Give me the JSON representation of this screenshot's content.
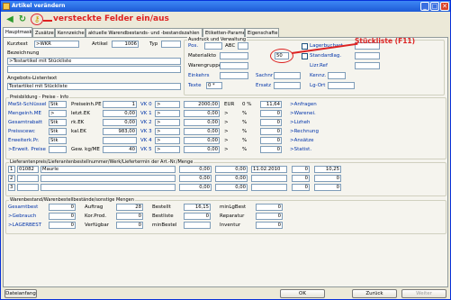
{
  "window": {
    "title": "Artikel verändern",
    "min": "_",
    "max": "□",
    "close": "✕"
  },
  "toolbar": {
    "icon1": "green-back-arrow",
    "icon2": "refresh-icon",
    "icon3": "key-icon",
    "annotation": "versteckte Felder ein/aus"
  },
  "tabs": [
    "Hauptmaske",
    "Zusätze",
    "Kennzeichen",
    "aktuelle Warendbestands- und -bestandszahlen",
    "Etiketten-Parameter",
    "Eigenschaften"
  ],
  "main": {
    "kurztext_label": "Kurztext",
    "kurztext_value": ">WKR",
    "artikel_label": "Artikel",
    "artikel_value": "1006",
    "typ_label": "Typ",
    "bezeichnung_label": "Bezeichnung",
    "bez1": ">Testartikel mit Stückliste",
    "angebots_label": "Angebots-Listentext",
    "angebots_value": "Testartikel mit Stückliste"
  },
  "right_group": {
    "title": "Ausdruck und Verwaltung",
    "pos_label": "Pos.",
    "abc_label": "ABC",
    "lagerbuch_label": "Lagerbuchart",
    "material_label": "Materialkto",
    "material_value": "50",
    "standardlag_label": "Standardlag.",
    "warengruppe_label": "Warengruppe",
    "lizref_label": "Lizr.Ref",
    "einkehrs_label": "Einkehrs",
    "sachnr_label": "Sachnr",
    "kennz_label": "Kennz.",
    "texte_label": "Texte",
    "texte_value": "0 *",
    "ersatz_label": "Ersatz",
    "lgort_label": "Lg-Ort",
    "stueckliste_annotation": "Stückliste (F11)"
  },
  "preis": {
    "title": "Preisbildung - Preise - Info",
    "rows": [
      {
        "label": "MwSt-Schlüssel",
        "unit": "Stk",
        "mid_label": "Preiseinh.PE",
        "mid_value": "1",
        "vk": "VK 0",
        "vk_label": ">",
        "price": "2000,00",
        "cur": "EUR",
        "pct": "0 %",
        "extra": "11,64",
        "link": ">Anfragen"
      },
      {
        "label": "Mengeinh.ME",
        "unit": ">",
        "mid_label": "letzt.EK",
        "mid_value": "0,00",
        "vk": "VK 1",
        "vk_label": ">",
        "price": "0,00",
        "cur": ">",
        "pct": "%",
        "extra": "0",
        "link": ">Warenei."
      },
      {
        "label": "Gesamtrabatt",
        "unit": "Stk",
        "mid_label": "rk.EK",
        "mid_value": "0,00",
        "vk": "VK 2",
        "vk_label": ">",
        "price": "0,00",
        "cur": ">",
        "pct": "%",
        "extra": "0",
        "link": ">Lizheh"
      },
      {
        "label": "Preisscewc",
        "unit": "Stk",
        "mid_label": "kal.EK",
        "mid_value": "983,00",
        "vk": "VK 3",
        "vk_label": ">",
        "price": "0,00",
        "cur": ">",
        "pct": "%",
        "extra": "0",
        "link": ">Rechnung"
      },
      {
        "label": "Erweiterk.Pr.",
        "unit": "Stk",
        "mid_label": "",
        "mid_value": "",
        "vk": "VK 4",
        "vk_label": ">",
        "price": "0,00",
        "cur": ">",
        "pct": "%",
        "extra": "0",
        "link": ">Ansätze"
      },
      {
        "label": ">Erweit. Preise",
        "unit": "",
        "mid_label": "Gew. kg/ME",
        "mid_value": "40",
        "vk": "VK 5",
        "vk_label": ">",
        "price": "0,00",
        "cur": ">",
        "pct": "%",
        "extra": "0",
        "link": ">Statist."
      }
    ]
  },
  "lieferanten": {
    "title": "Lieferantenpreis/Lieferantenbestellnummer/Werk/Liefertermin der Art.-Nr./Menge",
    "rows": [
      {
        "c1": "1",
        "c2": "01082",
        "c3": "Maurle",
        "p": "0,00",
        "e": "0,00",
        "d": "11.02.2010",
        "a": "0",
        "b": "10,25"
      },
      {
        "c1": "2",
        "c2": "",
        "c3": "",
        "p": "0,00",
        "e": "0,00",
        "d": "",
        "a": "0",
        "b": "0"
      },
      {
        "c1": "3",
        "c2": "",
        "c3": "",
        "p": "0,00",
        "e": "0,00",
        "d": "",
        "a": "0",
        "b": "0"
      }
    ]
  },
  "bestand": {
    "title": "Warenbestand/Warenbestellbestände/sonstige Mengen",
    "rows": [
      {
        "l1": "Gesamtbest",
        "v1": "0",
        "l2": "Auftrag",
        "v2": "28",
        "l3": "Bestellt",
        "v3": "16,15",
        "l4": "minLgBest",
        "v4": "0"
      },
      {
        "l1": ">Gebrauch",
        "v1": "0",
        "l2": "Kor.Prod.",
        "v2": "0",
        "l3": "Bestliste",
        "v3": "0",
        "l4": "Reparatur",
        "v4": "0"
      },
      {
        "l1": ">LAGERBEST",
        "v1": "0",
        "l2": "Verfügbar",
        "v2": "0",
        "l3": "minBestel",
        "v3": "",
        "l4": "Inventur",
        "v4": "0"
      }
    ]
  },
  "footer": {
    "left_button": "Dateianfang",
    "ok_button": "OK",
    "back_button": "Zurück",
    "next_button": "Weiter"
  }
}
